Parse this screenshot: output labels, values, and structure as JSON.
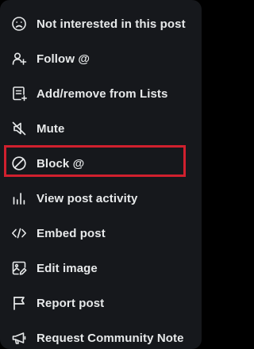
{
  "menu": {
    "items": [
      {
        "label": "Not interested in this post",
        "icon": "sad-face-icon"
      },
      {
        "label": "Follow @",
        "icon": "follow-user-icon"
      },
      {
        "label": "Add/remove from Lists",
        "icon": "list-icon"
      },
      {
        "label": "Mute",
        "icon": "mute-speaker-icon"
      },
      {
        "label": "Block @",
        "icon": "block-icon"
      },
      {
        "label": "View post activity",
        "icon": "analytics-bars-icon"
      },
      {
        "label": "Embed post",
        "icon": "code-brackets-icon"
      },
      {
        "label": "Edit image",
        "icon": "edit-image-icon"
      },
      {
        "label": "Report post",
        "icon": "flag-icon"
      },
      {
        "label": "Request Community Note",
        "icon": "megaphone-icon"
      }
    ],
    "highlighted_item": "Block @",
    "colors": {
      "background": "#16181c",
      "text": "#e7e9ea",
      "highlight": "#d0202e"
    }
  }
}
